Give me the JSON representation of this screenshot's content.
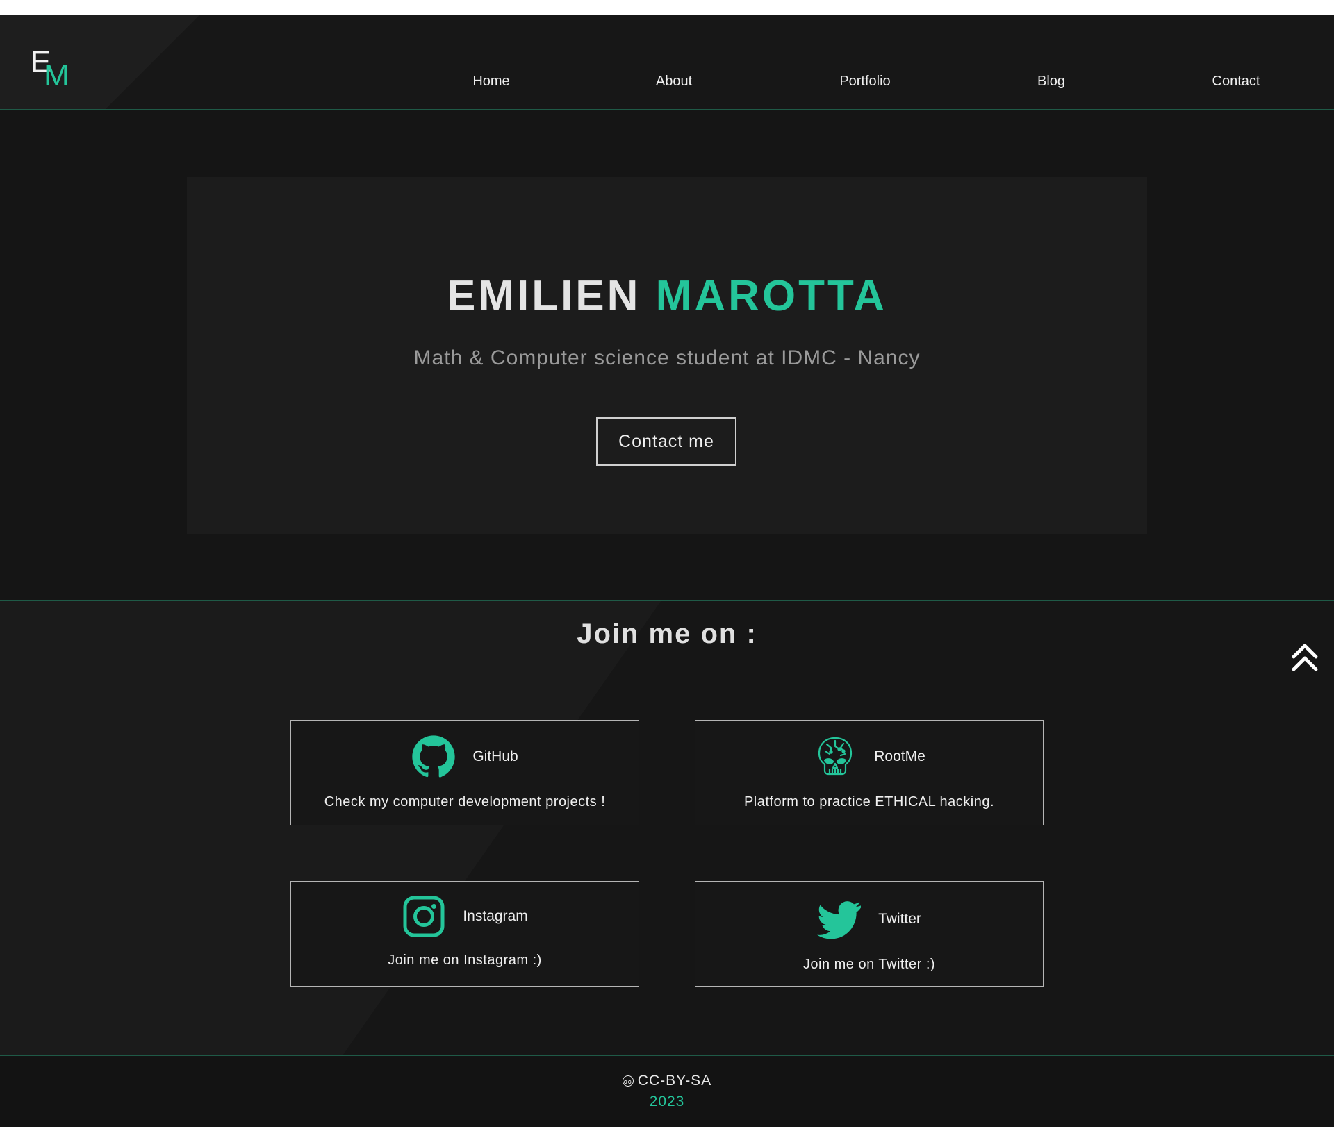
{
  "brand": {
    "logo_first": "E",
    "logo_second": "M"
  },
  "nav": {
    "items": [
      {
        "label": "Home"
      },
      {
        "label": "About"
      },
      {
        "label": "Portfolio"
      },
      {
        "label": "Blog"
      },
      {
        "label": "Contact"
      }
    ]
  },
  "hero": {
    "first_name": "EMILIEN",
    "last_name": "MAROTTA",
    "subtitle": "Math & Computer science student at IDMC - Nancy",
    "cta_label": "Contact me"
  },
  "social": {
    "title": "Join me on :",
    "cards": [
      {
        "name": "GitHub",
        "description": "Check my computer development projects !",
        "icon": "github-icon"
      },
      {
        "name": "RootMe",
        "description": "Platform to practice ETHICAL hacking.",
        "icon": "rootme-skull-icon"
      },
      {
        "name": "Instagram",
        "description": "Join me on Instagram :)",
        "icon": "instagram-icon"
      },
      {
        "name": "Twitter",
        "description": "Join me on Twitter :)",
        "icon": "twitter-bird-icon"
      }
    ]
  },
  "footer": {
    "license_icon": "creative-commons-icon",
    "license": "CC-BY-SA",
    "year": "2023"
  },
  "colors": {
    "accent": "#24c59a",
    "background": "#171717",
    "card": "#1c1c1c",
    "divider": "#1f5a47"
  }
}
